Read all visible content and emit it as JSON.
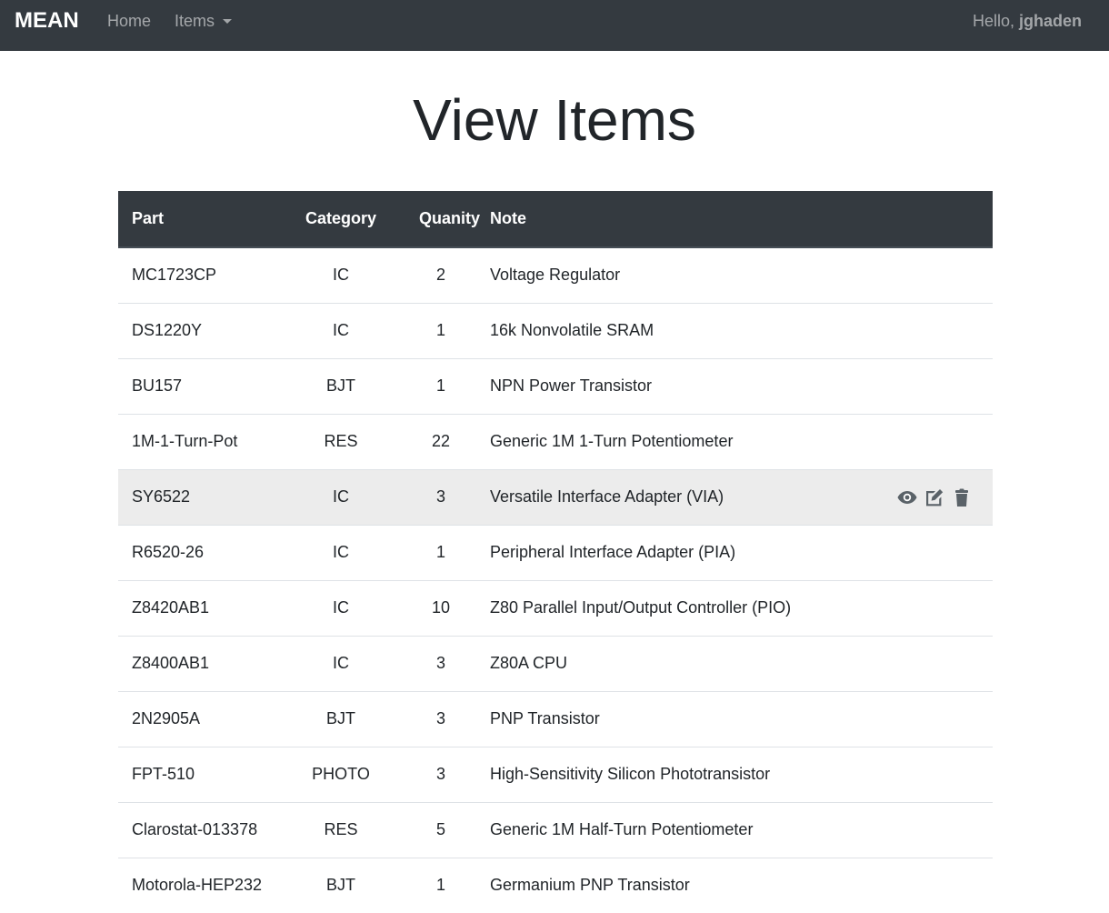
{
  "navbar": {
    "brand": "MEAN",
    "home": "Home",
    "items": "Items",
    "greeting_prefix": "Hello, ",
    "username": "jghaden"
  },
  "page": {
    "title": "View Items"
  },
  "table": {
    "headers": {
      "part": "Part",
      "category": "Category",
      "quantity": "Quanity",
      "note": "Note"
    },
    "rows": [
      {
        "part": "MC1723CP",
        "category": "IC",
        "quantity": "2",
        "note": "Voltage Regulator"
      },
      {
        "part": "DS1220Y",
        "category": "IC",
        "quantity": "1",
        "note": "16k Nonvolatile SRAM"
      },
      {
        "part": "BU157",
        "category": "BJT",
        "quantity": "1",
        "note": "NPN Power Transistor"
      },
      {
        "part": "1M-1-Turn-Pot",
        "category": "RES",
        "quantity": "22",
        "note": "Generic 1M 1-Turn Potentiometer"
      },
      {
        "part": "SY6522",
        "category": "IC",
        "quantity": "3",
        "note": "Versatile Interface Adapter (VIA)"
      },
      {
        "part": "R6520-26",
        "category": "IC",
        "quantity": "1",
        "note": "Peripheral Interface Adapter (PIA)"
      },
      {
        "part": "Z8420AB1",
        "category": "IC",
        "quantity": "10",
        "note": "Z80 Parallel Input/Output Controller (PIO)"
      },
      {
        "part": "Z8400AB1",
        "category": "IC",
        "quantity": "3",
        "note": "Z80A CPU"
      },
      {
        "part": "2N2905A",
        "category": "BJT",
        "quantity": "3",
        "note": "PNP Transistor"
      },
      {
        "part": "FPT-510",
        "category": "PHOTO",
        "quantity": "3",
        "note": "High-Sensitivity Silicon Phototransistor"
      },
      {
        "part": "Clarostat-013378",
        "category": "RES",
        "quantity": "5",
        "note": "Generic 1M Half-Turn Potentiometer"
      },
      {
        "part": "Motorola-HEP232",
        "category": "BJT",
        "quantity": "1",
        "note": "Germanium PNP Transistor"
      }
    ],
    "hovered_row": 4,
    "row_action_icons": [
      "eye-icon",
      "edit-icon",
      "trash-icon"
    ]
  },
  "colors": {
    "navbar_bg": "#343a40",
    "table_header_bg": "#343a40",
    "hover_row_bg": "#ececec",
    "icon_color": "#5a6268"
  }
}
